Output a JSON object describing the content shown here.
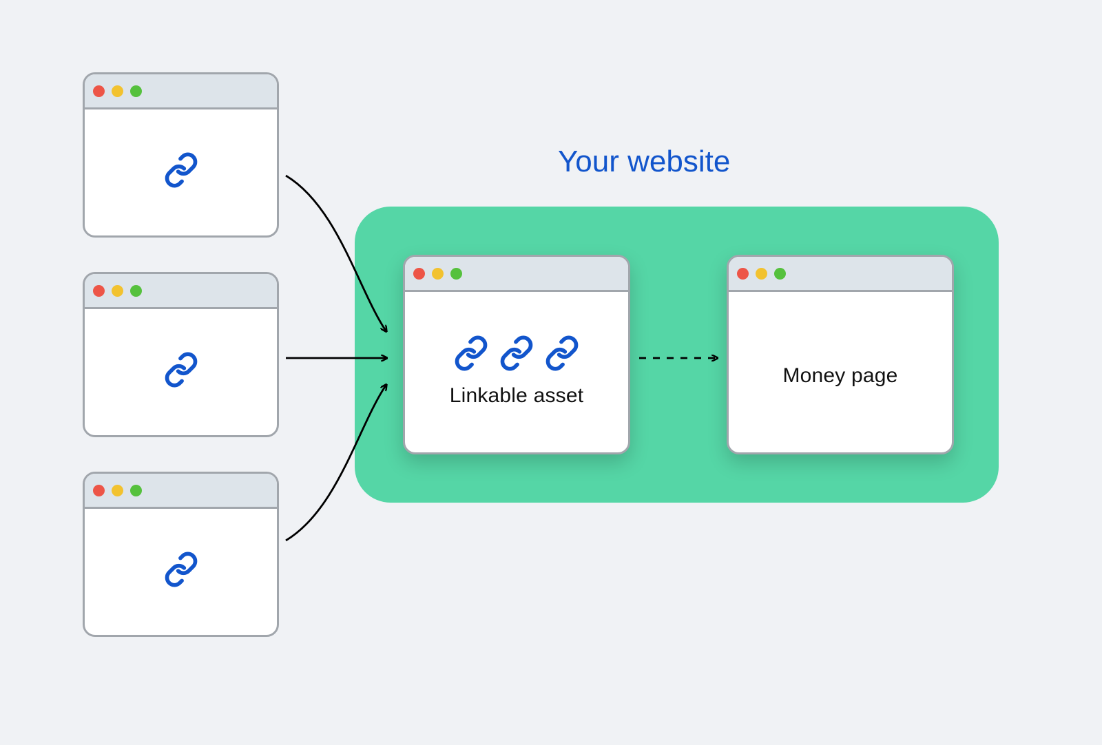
{
  "headline": "Your website",
  "linkable_asset_label": "Linkable asset",
  "money_page_label": "Money page",
  "colors": {
    "background": "#f0f2f5",
    "window_border": "#a1a6ac",
    "window_titlebar": "#dde4ea",
    "website_box": "#55d6a6",
    "headline_text": "#1255cc",
    "link_icon": "#1255cc",
    "traffic_red": "#ed5547",
    "traffic_yellow": "#f2c22f",
    "traffic_green": "#55c13d"
  },
  "icons": {
    "link": "link-icon"
  }
}
